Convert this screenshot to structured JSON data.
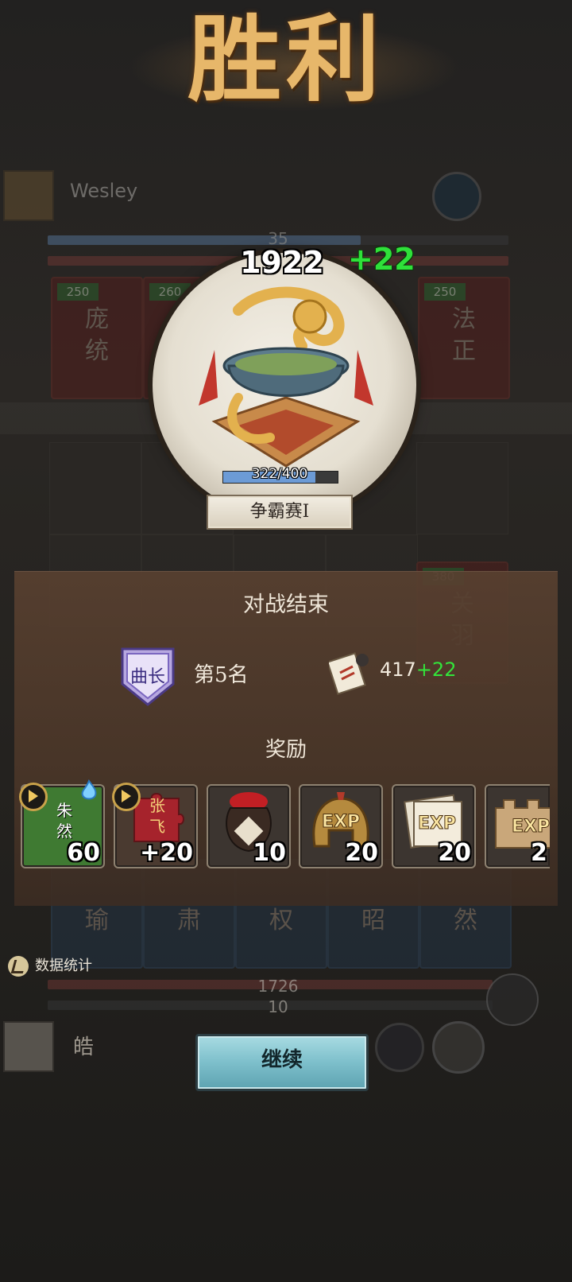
{
  "title": "胜利",
  "top_player": {
    "name": "Wesley",
    "level_bar_value": "35"
  },
  "rank": {
    "score": "1922",
    "score_delta": "+22",
    "exp_text": "322/400",
    "exp_progress": 0.805,
    "league": "争霸赛I"
  },
  "result": {
    "heading": "对战结束",
    "rank_badge_text": "曲长",
    "placement": "第5名",
    "points": "417",
    "points_delta": "+22",
    "rewards_heading": "奖励",
    "rewards": [
      {
        "label": "朱然",
        "qty": "60",
        "has_play": true
      },
      {
        "label": "张飞",
        "qty": "+20",
        "has_play": true
      },
      {
        "label": "酒",
        "qty": "10",
        "has_play": false
      },
      {
        "label": "EXP",
        "qty": "20",
        "has_play": false
      },
      {
        "label": "EXP",
        "qty": "20",
        "has_play": false
      },
      {
        "label": "EXP",
        "qty": "2",
        "has_play": false
      }
    ]
  },
  "board": {
    "top_cards": [
      {
        "cost": "250",
        "name1": "庞",
        "name2": "统"
      },
      {
        "cost": "260",
        "name1": "",
        "name2": ""
      },
      {
        "cost": "250",
        "name1": "法",
        "name2": "正"
      }
    ],
    "side_card": {
      "cost": "380",
      "name1": "关",
      "name2": "羽"
    },
    "bottom_cards": [
      {
        "name": "瑜"
      },
      {
        "name": "肃"
      },
      {
        "name": "权"
      },
      {
        "name": "昭"
      },
      {
        "name": "然"
      }
    ],
    "bottom_bar_top": "1726",
    "bottom_bar_bottom": "10"
  },
  "bottom_player": {
    "name": "皓"
  },
  "data_stats_label": "数据统计",
  "continue_label": "继续",
  "colors": {
    "win_gold": "#e7b76a",
    "delta_green": "#2fe03a",
    "continue_bg": "#7dbfcb"
  }
}
